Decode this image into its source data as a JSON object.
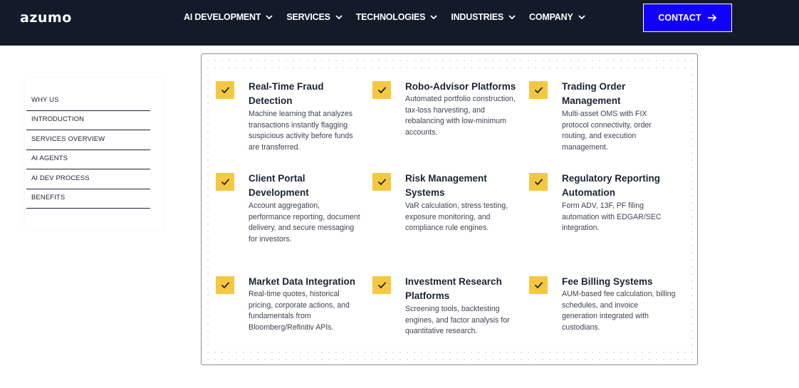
{
  "header": {
    "logo": "azumo",
    "nav": [
      {
        "label": "AI DEVELOPMENT"
      },
      {
        "label": "SERVICES"
      },
      {
        "label": "TECHNOLOGIES"
      },
      {
        "label": "INDUSTRIES"
      },
      {
        "label": "COMPANY"
      }
    ],
    "contact_label": "CONTACT",
    "colors": {
      "bar": "#141a2a",
      "cta": "#1100ff"
    }
  },
  "toc": {
    "items": [
      {
        "label": "WHY US"
      },
      {
        "label": "INTRODUCTION"
      },
      {
        "label": "SERVICES OVERVIEW"
      },
      {
        "label": "AI AGENTS"
      },
      {
        "label": "AI DEV PROCESS"
      },
      {
        "label": "BENEFITS"
      }
    ]
  },
  "features": [
    {
      "title": "Real-Time Fraud Detection",
      "desc": "Machine learning that analyzes transactions instantly flagging suspicious activity before funds are transferred.",
      "icon": "check-icon"
    },
    {
      "title": "Robo-Advisor Platforms",
      "desc": "Automated portfolio construction, tax-loss harvesting, and rebalancing with low-minimum accounts.",
      "icon": "check-icon"
    },
    {
      "title": "Trading Order Management",
      "desc": "Multi-asset OMS with FIX protocol connectivity, order routing, and execution management.",
      "icon": "check-icon"
    },
    {
      "title": "Client Portal Development",
      "desc": "Account aggregation, performance reporting, document delivery, and secure messaging for investors.",
      "icon": "check-icon"
    },
    {
      "title": "Risk Management Systems",
      "desc": "VaR calculation, stress testing, exposure monitoring, and compliance rule engines.",
      "icon": "check-icon"
    },
    {
      "title": "Regulatory Reporting Automation",
      "desc": "Form ADV, 13F, PF filing automation with EDGAR/SEC integration.",
      "icon": "check-icon"
    },
    {
      "title": "Market Data Integration",
      "desc": "Real-time quotes, historical pricing, corporate actions, and fundamentals from Bloomberg/Refinitiv APIs.",
      "icon": "check-icon"
    },
    {
      "title": "Investment Research Platforms",
      "desc": "Screening tools, backtesting engines, and factor analysis for quantitative research.",
      "icon": "check-icon"
    },
    {
      "title": "Fee Billing Systems",
      "desc": "AUM-based fee calculation, billing schedules, and invoice generation integrated with custodians.",
      "icon": "check-icon"
    }
  ],
  "accent_color": "#f5c842"
}
